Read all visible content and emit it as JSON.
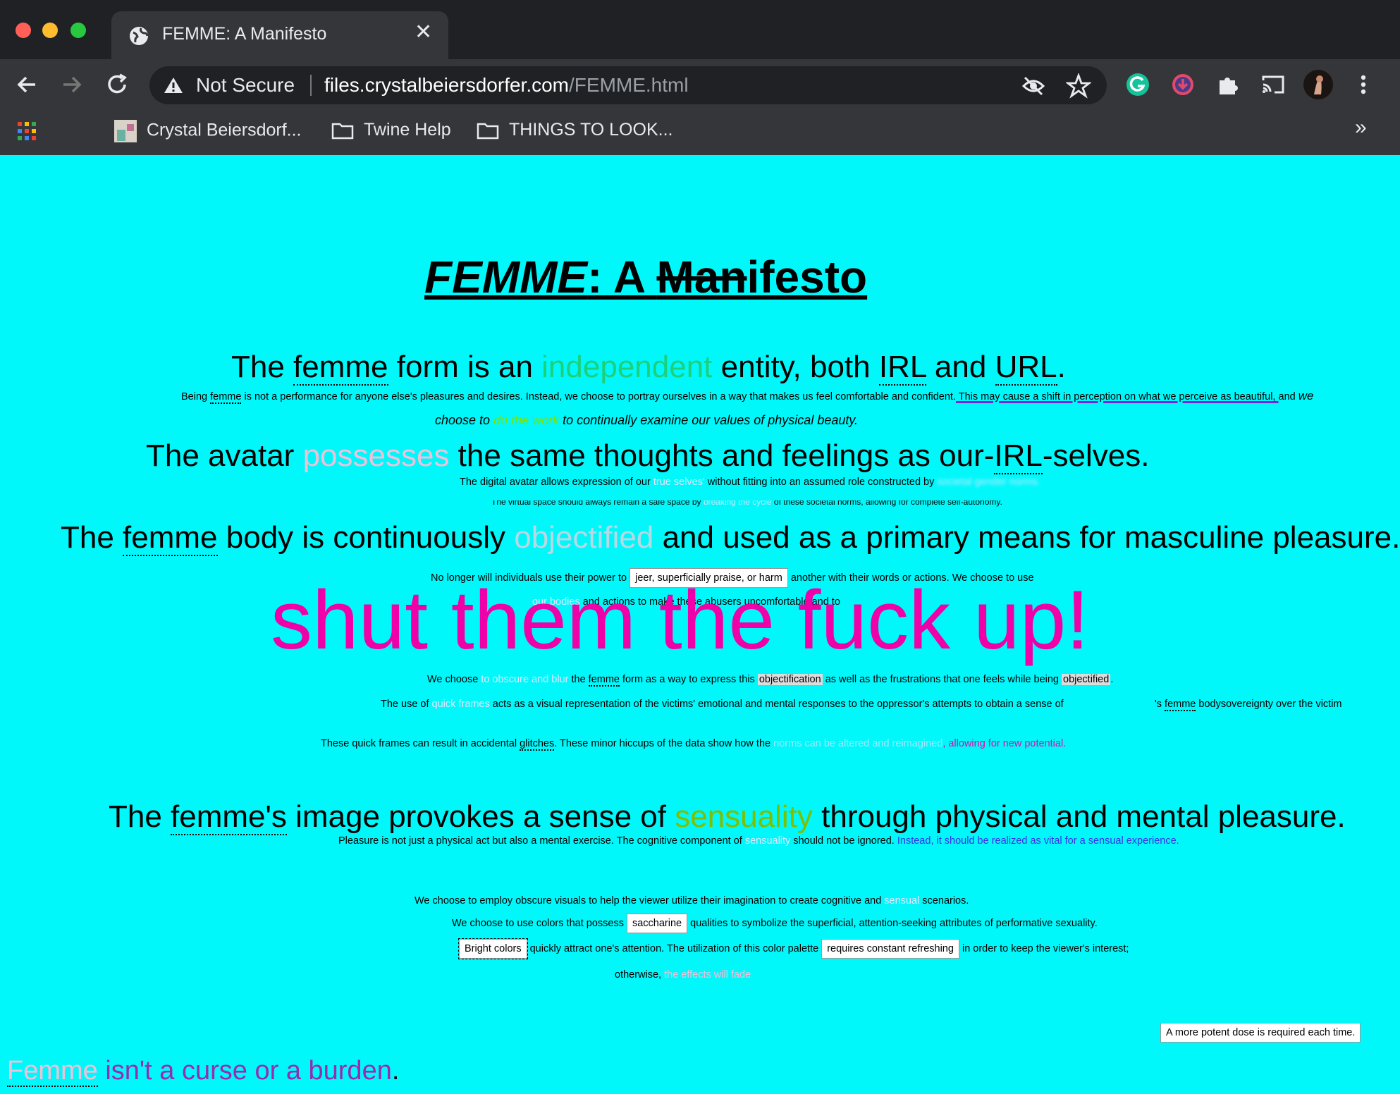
{
  "browser": {
    "tab_title": "FEMME: A Manifesto",
    "security_label": "Not Secure",
    "url_domain": "files.crystalbeiersdorfer.com",
    "url_path": "/FEMME.html",
    "bookmarks": [
      {
        "label": "Crystal Beiersdorf..."
      },
      {
        "label": "Twine Help"
      },
      {
        "label": "THINGS TO LOOK..."
      }
    ],
    "more_label": "»"
  },
  "page": {
    "title_italic": "FEMME",
    "title_mid": ": A ",
    "title_strike": "Man",
    "title_end": "ifesto",
    "s1": {
      "a": "The ",
      "femme": "femme",
      "b": " form is an ",
      "hl": "independent",
      "c": " entity, both ",
      "irl": "IRL",
      "d": " and ",
      "url": "URL",
      "e": "."
    },
    "s1_body": {
      "a": "Being ",
      "femme": "femme",
      "b": " is not a performance for anyone else's pleasures and desires. Instead, we choose to portray ourselves in a way that makes us feel comfortable and confident.",
      "c": " This may cause a shift in perception on what we perceive as beautiful, ",
      "d": "and ",
      "e": "we",
      "f": "choose to ",
      "g": "do the work",
      "h": " to continually examine our values of physical beauty."
    },
    "s2": {
      "a": "The avatar ",
      "hl": "possesses",
      "b": " the same thoughts and feelings as our-",
      "irl": "IRL",
      "c": "-selves."
    },
    "s2_body": {
      "a": "The digital avatar allows expression of our ",
      "hl": "true selves'",
      "b": " without fitting into an assumed role constructed by ",
      "blur": "societal gender norms.",
      "c": "The virtual space should always remain a safe space by ",
      "blur2": "breaking the cycle",
      "d": " of these societal norms, allowing for complete self-autonomy."
    },
    "s3": {
      "a": "The ",
      "femme": "femme",
      "b": " body is continuously ",
      "hl": "objectified",
      "c": " and used as a primary means for masculine pleasure."
    },
    "s3_body": {
      "a": "No longer will individuals use their power to ",
      "box": "jeer, superficially praise, or harm",
      "b": " another with their words or actions. We choose to use",
      "c": "our bodies",
      "d": " and actions to make these abusers uncomfortable and to"
    },
    "shout": "shut them the fuck up!",
    "s3_body2": {
      "a": "We choose ",
      "hl": "to obscure and blur",
      "b": " the ",
      "femme": "femme",
      "c": " form as a way to express this ",
      "obj": "objectification",
      "d": " as well as the frustrations that one feels while being ",
      "obj2": "objectified",
      "e": "."
    },
    "s3_body3": {
      "a": "The use of ",
      "hl": "quick frames",
      "b": " acts as a visual representation of the victims' emotional and mental responses to the oppressor's attempts to obtain a sense of",
      "c": "'s ",
      "femme": "femme",
      "d": " body",
      "e": "sovereignty over the victim"
    },
    "s3_body4": {
      "a": "These quick frames can result in accidental ",
      "glitches": "glitches",
      "b": ". These minor hiccups of the data show how the ",
      "hl": "norms can be altered and reimagined",
      "c": ", allowing for new potential."
    },
    "s4": {
      "a": "The ",
      "femme": "femme's",
      "b": " image provokes a sense of ",
      "hl": "sensuality",
      "c": " through physical and mental pleasure."
    },
    "s4_body": {
      "a": "Pleasure is not just a physical act but also a mental exercise. The cognitive component of ",
      "hl": "sensuality",
      "b": " should not be ignored. ",
      "c": "Instead, it should be realized as vital for a sensual experience."
    },
    "s4_body2": {
      "a": "We choose to employ obscure visuals to help the viewer utilize their imagination to create cognitive and ",
      "hl": "sensual",
      "b": " scenarios."
    },
    "s4_body3": {
      "a": "We choose to use colors that possess ",
      "box": "saccharine",
      "b": " qualities to symbolize the superficial, attention-seeking attributes of performative sexuality."
    },
    "s4_body4": {
      "box1": "Bright colors",
      "a": " quickly attract one's attention. The utilization of this color palette ",
      "box2": "requires constant refreshing",
      "b": " in order to keep the viewer's interest;"
    },
    "s4_body5": {
      "a": "otherwise, ",
      "hl": "the effects will fade"
    },
    "potent": "A more potent dose is required each time.",
    "last": {
      "femme": "Femme",
      "a": " isn't a curse or a burden",
      "b": "."
    }
  },
  "colors": {
    "page_bg": "#00f8fb",
    "green": "#1dd07a",
    "lime": "#7ee000",
    "pink": "#f0c0d8",
    "magenta": "#f000a8",
    "purple": "#9a2ab0",
    "blue": "#3b2ee8"
  }
}
